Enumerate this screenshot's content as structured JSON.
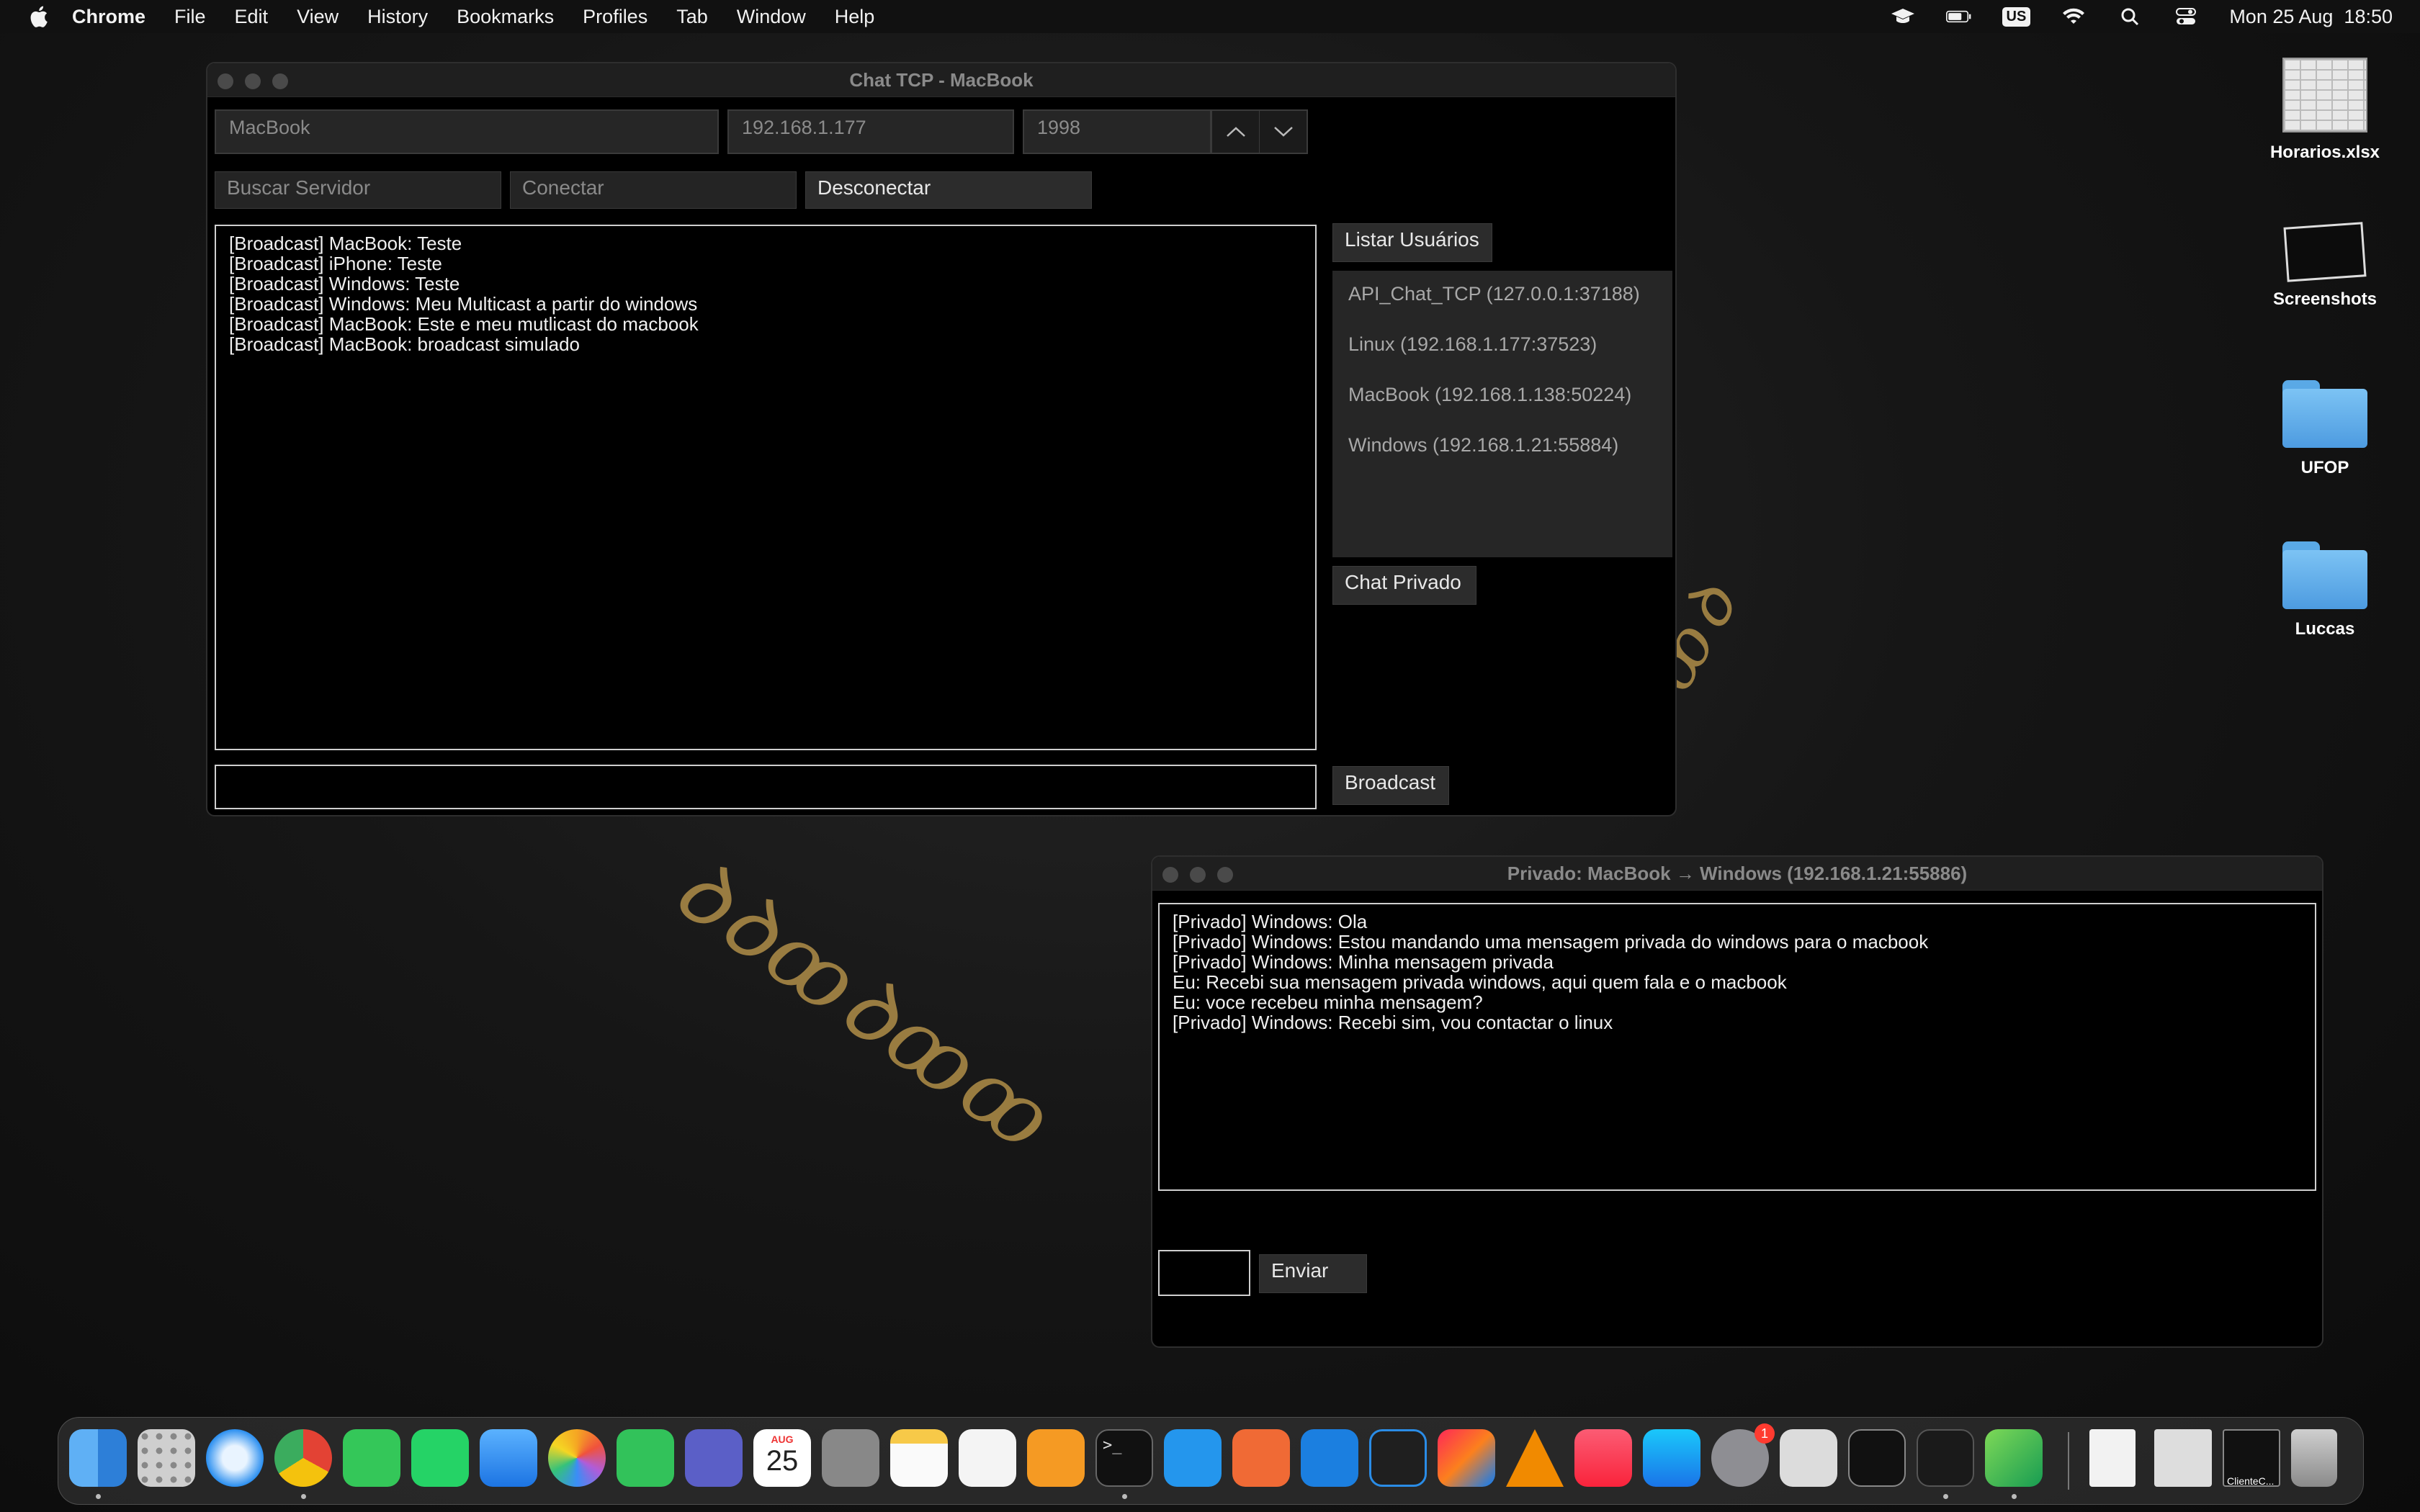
{
  "menubar": {
    "app": "Chrome",
    "items": [
      "File",
      "Edit",
      "View",
      "History",
      "Bookmarks",
      "Profiles",
      "Tab",
      "Window",
      "Help"
    ],
    "input_source": "US",
    "clock": "Mon 25 Aug  18:50"
  },
  "main_window": {
    "title": "Chat TCP - MacBook",
    "name_field": "MacBook",
    "ip_field": "192.168.1.177",
    "port_field": "1998",
    "search_server_label": "Buscar Servidor",
    "connect_label": "Conectar",
    "disconnect_label": "Desconectar",
    "list_users_label": "Listar Usuários",
    "private_chat_label": "Chat Privado",
    "broadcast_label": "Broadcast",
    "broadcast_input": "",
    "messages": [
      "[Broadcast] MacBook: Teste",
      "[Broadcast] iPhone: Teste",
      "[Broadcast] Windows: Teste",
      "[Broadcast] Windows: Meu Multicast a partir do windows",
      "[Broadcast] MacBook: Este e meu mutlicast do macbook",
      "[Broadcast] MacBook: broadcast simulado"
    ],
    "users": [
      "API_Chat_TCP (127.0.0.1:37188)",
      "Linux (192.168.1.177:37523)",
      "MacBook (192.168.1.138:50224)",
      "Windows (192.168.1.21:55884)"
    ]
  },
  "private_window": {
    "title": "Privado: MacBook → Windows (192.168.1.21:55886)",
    "messages": [
      "[Privado] Windows: Ola",
      "[Privado] Windows: Estou mandando uma mensagem privada do windows para o macbook",
      "[Privado] Windows: Minha mensagem privada",
      "Eu: Recebi sua mensagem privada windows, aqui quem fala e o macbook",
      "Eu: voce recebeu minha mensagem?",
      "[Privado] Windows: Recebi sim, vou contactar o linux"
    ],
    "input": "",
    "send_label": "Enviar"
  },
  "desktop_icons": [
    {
      "label": "Horarios.xlsx",
      "icon": "xlsx-file-icon"
    },
    {
      "label": "Screenshots",
      "icon": "screenshots-folder-icon"
    },
    {
      "label": "UFOP",
      "icon": "folder-icon"
    },
    {
      "label": "Luccas",
      "icon": "folder-icon"
    }
  ],
  "dock": {
    "calendar_month": "AUG",
    "calendar_day": "25",
    "settings_badge": "1",
    "terminal_thumb_label": "ClienteC..."
  },
  "colors": {
    "window_bg": "#000000",
    "field_bg": "#262626",
    "button_bg": "#2c2c2c",
    "ring_gold": "#b08e48",
    "folder_blue": "#5aa9e6"
  }
}
